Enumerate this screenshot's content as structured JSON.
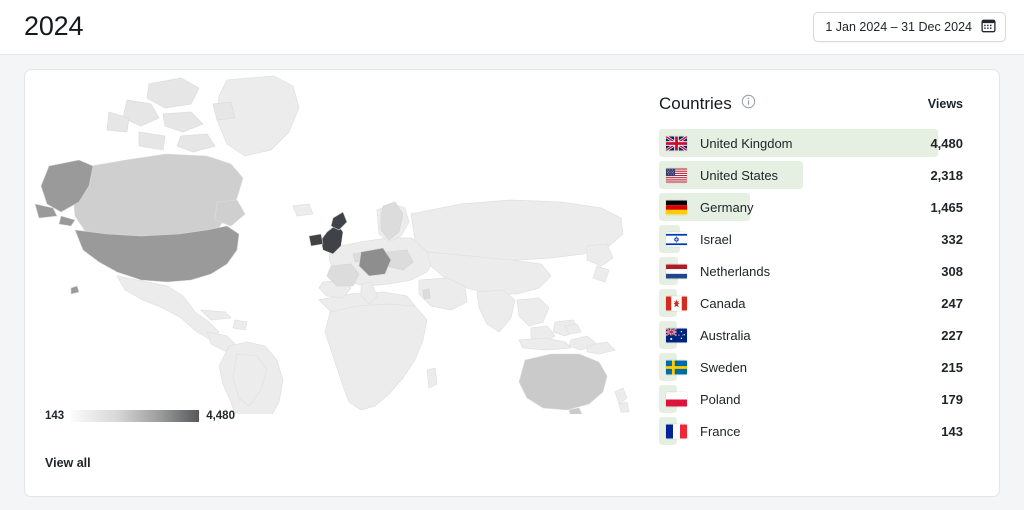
{
  "header": {
    "title": "2024",
    "date_range_label": "1 Jan 2024 – 31 Dec 2024",
    "calendar_icon": "calendar-icon"
  },
  "card": {
    "map": {
      "legend_min": "143",
      "legend_max": "4,480",
      "view_all_label": "View all",
      "gradient_from": "#fbfbfb",
      "gradient_to": "#55585c",
      "land_default": "#ececec",
      "ocean": "#ffffff"
    },
    "list": {
      "title": "Countries",
      "info_icon": "info-icon",
      "views_header": "Views",
      "bar_color": "#e6f0e2",
      "max_value": 4480,
      "rows": [
        {
          "country": "United Kingdom",
          "code": "gb",
          "views": "4,480",
          "value": 4480
        },
        {
          "country": "United States",
          "code": "us",
          "views": "2,318",
          "value": 2318
        },
        {
          "country": "Germany",
          "code": "de",
          "views": "1,465",
          "value": 1465
        },
        {
          "country": "Israel",
          "code": "il",
          "views": "332",
          "value": 332
        },
        {
          "country": "Netherlands",
          "code": "nl",
          "views": "308",
          "value": 308
        },
        {
          "country": "Canada",
          "code": "ca",
          "views": "247",
          "value": 247
        },
        {
          "country": "Australia",
          "code": "au",
          "views": "227",
          "value": 227
        },
        {
          "country": "Sweden",
          "code": "se",
          "views": "215",
          "value": 215
        },
        {
          "country": "Poland",
          "code": "pl",
          "views": "179",
          "value": 179
        },
        {
          "country": "France",
          "code": "fr",
          "views": "143",
          "value": 143
        }
      ]
    }
  },
  "chart_data": {
    "type": "bar",
    "title": "Countries",
    "xlabel": "",
    "ylabel": "Views",
    "categories": [
      "United Kingdom",
      "United States",
      "Germany",
      "Israel",
      "Netherlands",
      "Canada",
      "Australia",
      "Sweden",
      "Poland",
      "France"
    ],
    "values": [
      4480,
      2318,
      1465,
      332,
      308,
      247,
      227,
      215,
      179,
      143
    ],
    "legend": [
      "Views"
    ],
    "grid": false,
    "ylim": [
      0,
      4480
    ],
    "map_scale_min": 143,
    "map_scale_max": 4480
  }
}
